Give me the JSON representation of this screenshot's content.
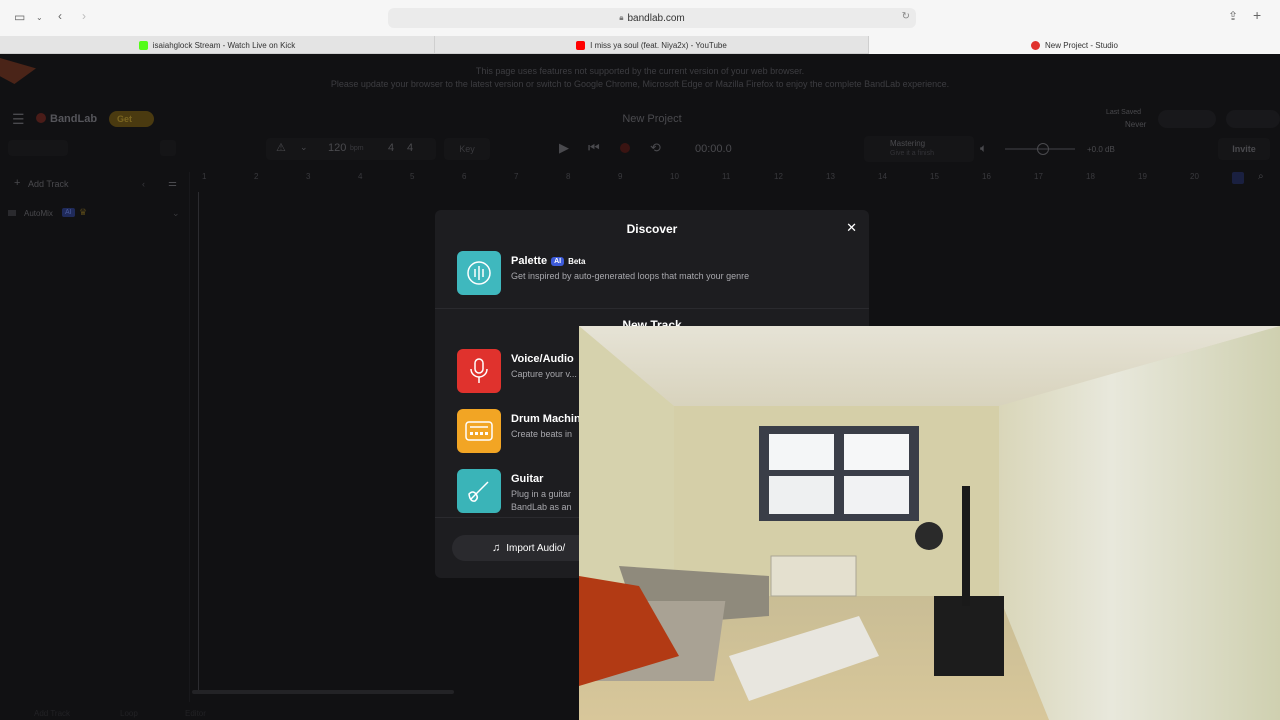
{
  "browser": {
    "url": "bandlab.com",
    "tabs": [
      {
        "label": "isaiahglock Stream - Watch Live on Kick",
        "favicon_color": "#53fc18"
      },
      {
        "label": "I miss ya soul (feat. Niya2x) - YouTube",
        "favicon_color": "#ff0000"
      },
      {
        "label": "New Project - Studio",
        "favicon_color": "#e0322d"
      }
    ]
  },
  "app": {
    "warning": {
      "line1": "This page uses features not supported by the current version of your web browser.",
      "line2": "Please update your browser to the latest version or switch to Google Chrome, Microsoft Edge or Mazilla Firefox to enjoy the complete BandLab experience."
    },
    "brand": "BandLab",
    "get_label": "Get",
    "project_title": "New Project",
    "last_saved_label": "Last Saved",
    "last_saved_value": "Never",
    "tempo": "120",
    "tempo_unit": "bpm",
    "time_sig_top": "4",
    "time_sig_bottom": "4",
    "key": "Key",
    "time": "00:00.0",
    "mastering_label": "Mastering",
    "mastering_sub": "Give it a finish",
    "volume": "+0.0 dB",
    "invite_label": "Invite",
    "add_track_label": "Add Track",
    "automix_label": "AutoMix",
    "automix_badge": "AI",
    "ruler": [
      "1",
      "2",
      "3",
      "4",
      "5",
      "6",
      "7",
      "8",
      "9",
      "10",
      "11",
      "12",
      "13",
      "14",
      "15",
      "16",
      "17",
      "18",
      "19",
      "20"
    ],
    "bottom_items": [
      "Add Track",
      "Loop",
      "Editor"
    ]
  },
  "modal": {
    "title": "Discover",
    "palette": {
      "title": "Palette",
      "badge_ai": "AI",
      "badge_beta": "Beta",
      "desc": "Get inspired by auto-generated loops that match your genre"
    },
    "new_track_title": "New Track",
    "items": [
      {
        "title": "Voice/Audio",
        "desc": "Capture your v... sound",
        "color": "#e0322d"
      },
      {
        "title": "Drum Machin",
        "desc": "Create beats in",
        "color": "#f2a524"
      },
      {
        "title": "Guitar",
        "desc": "Plug in a guitar BandLab as an",
        "color": "#3ab4b8"
      }
    ],
    "import_label": "Import Audio/"
  },
  "colors": {
    "palette_icon": "#3fb8be",
    "accent": "#e0322d"
  }
}
